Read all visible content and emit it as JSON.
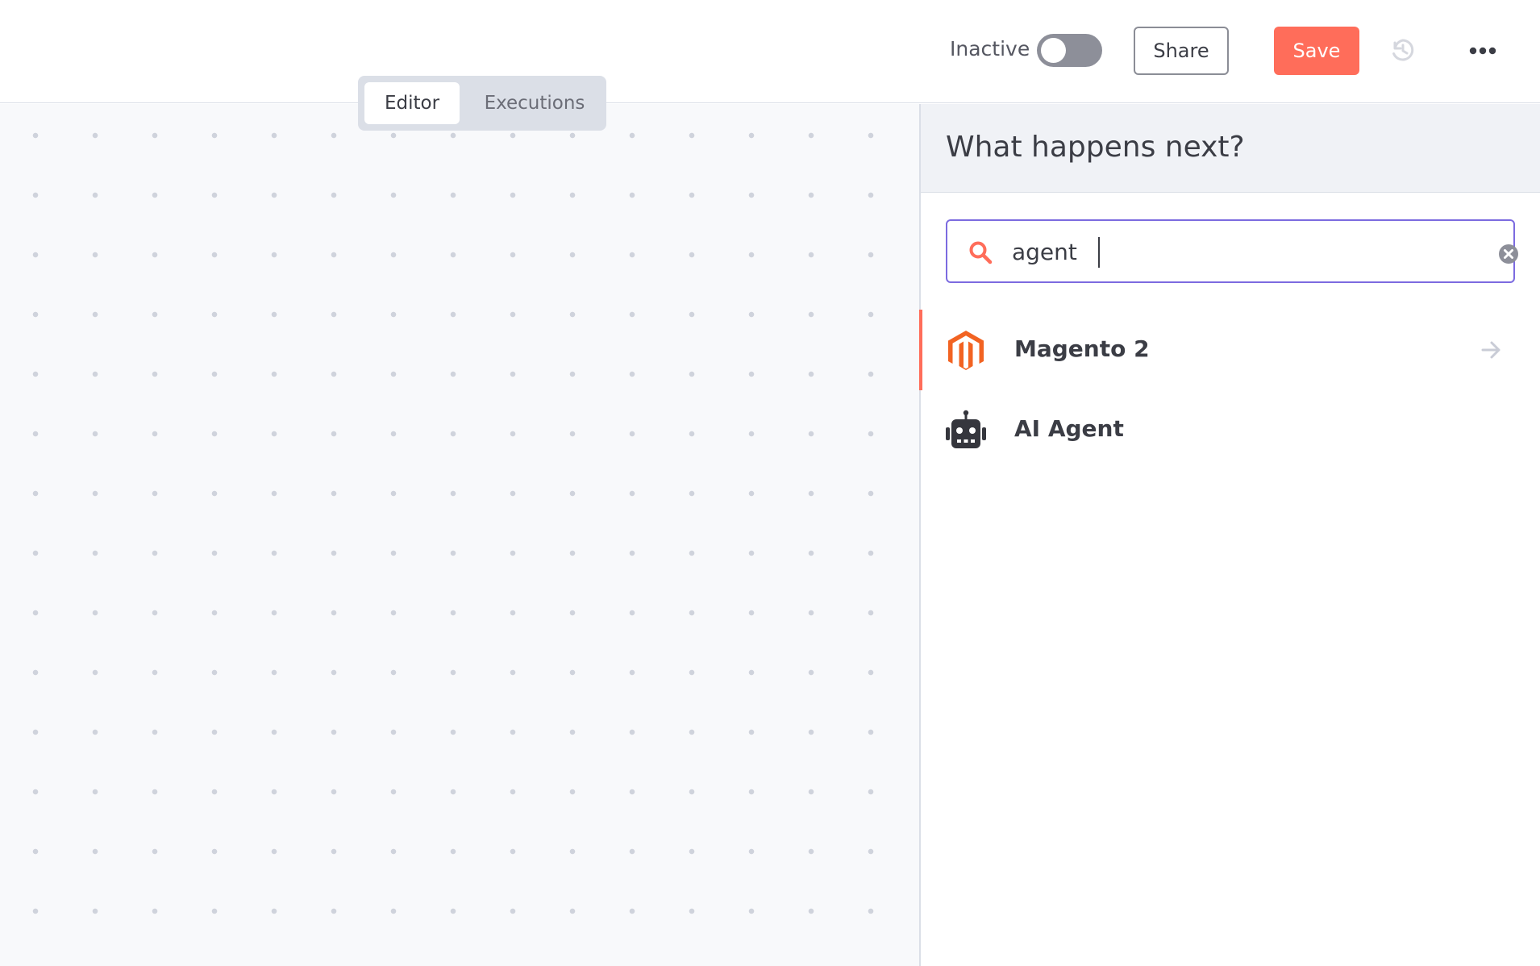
{
  "header": {
    "status_label": "Inactive",
    "active_toggle": false,
    "share_label": "Share",
    "save_label": "Save",
    "icons": [
      "history-icon",
      "more-options-icon"
    ],
    "colors": {
      "save": "#ff6d5a",
      "toggle_off": "#8d8f99"
    }
  },
  "tabs": [
    {
      "label": "Editor",
      "selected": true
    },
    {
      "label": "Executions",
      "selected": false
    }
  ],
  "node_creator": {
    "title": "What happens next?",
    "search": {
      "value": "agent",
      "placeholder": "",
      "icon": "search-icon",
      "clear_icon": "clear-icon"
    },
    "results": [
      {
        "label": "Magento 2",
        "icon": "magento-icon",
        "active": true,
        "icon_color": "#f26322"
      },
      {
        "label": "AI Agent",
        "icon": "robot-icon",
        "active": false,
        "icon_color": "#35363d"
      }
    ],
    "accent_color": "#7c6be0"
  }
}
